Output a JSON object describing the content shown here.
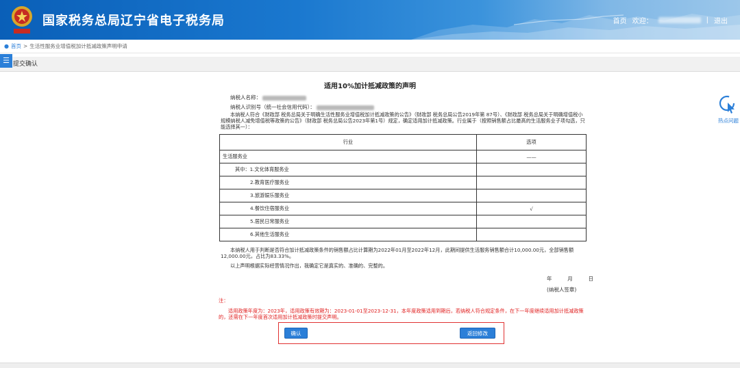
{
  "header": {
    "title": "国家税务总局辽宁省电子税务局",
    "nav_home": "首页",
    "nav_welcome": "欢迎：",
    "separator": "|",
    "nav_logout": "退出",
    "colors": {
      "header_blue": "#0a5fb8",
      "accent": "#2b7fd8"
    }
  },
  "breadcrumb": {
    "home": "首页",
    "separator": ">",
    "current": "生活性服务业增值税加计抵减政策声明申请"
  },
  "section": {
    "menu_icon": "menu-icon",
    "title": "提交确认"
  },
  "float_help": {
    "icon": "help-cursor-icon",
    "label": "热点问题"
  },
  "declaration": {
    "title": "适用10%加计抵减政策的声明",
    "taxpayer_name_label": "纳税人名称：",
    "taxpayer_id_label": "纳税人识别号（统一社会信用代码）：",
    "intro": "本纳税人符合《财政部 税务总局关于明确生活性服务业增值税加计抵减政策的公告》（财政部 税务总局公告2019年第 87号）、《财政部 税务总局关于明确增值税小规模纳税人减免增值税等政策的公告》（财政部 税务总局公告2023年第1号）规定，确定适用加计抵减政策。行业属于（按照销售额占比最高的生活服务业子项勾选，只能选择其一）：",
    "table": {
      "headers": [
        "行业",
        "选项"
      ],
      "rows": [
        {
          "label": "生活服务业",
          "option": "——",
          "level": 0
        },
        {
          "label": "其中：1.文化体育服务业",
          "option": "",
          "level": 1
        },
        {
          "label": "2.教育医疗服务业",
          "option": "",
          "level": 2
        },
        {
          "label": "3.旅游娱乐服务业",
          "option": "",
          "level": 2
        },
        {
          "label": "4.餐饮住宿服务业",
          "option": "√",
          "level": 2
        },
        {
          "label": "5.居民日常服务业",
          "option": "",
          "level": 2
        },
        {
          "label": "6.其他生活服务业",
          "option": "",
          "level": 2
        }
      ]
    },
    "period_text": "本纳税人用于判断是否符合加计抵减政策条件的销售额占比计算期为2022年01月至2022年12月，此期间提供生活服务销售额合计10,000.00元，全部销售额12,000.00元，占比为83.33%。",
    "statement": "以上声明根据实际经营情况作出，我确定它是真实的、准确的、完整的。",
    "date_year": "年",
    "date_month": "月",
    "date_day": "日",
    "seal": "(纳税人签章)",
    "note_label": "注：",
    "note_text": "适用政策年度为：2023年，适用政策有效期为：2023-01-01至2023-12-31，本年度政策适用到期后，若纳税人符合规定条件，在下一年度继续适用加计抵减政策的，还需在下一年度首次适用加计抵减政策时提交声明。"
  },
  "actions": {
    "confirm": "确认",
    "back": "返回修改"
  }
}
